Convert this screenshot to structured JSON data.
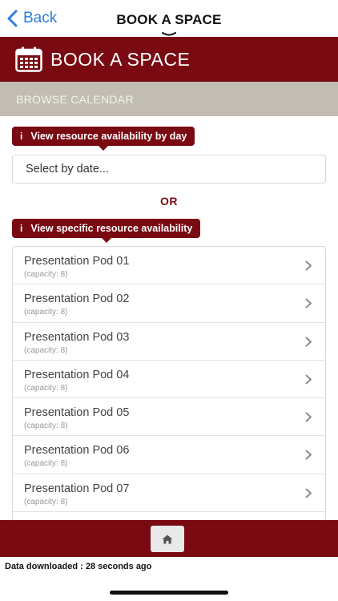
{
  "navbar": {
    "back_label": "Back",
    "title": "BOOK A SPACE"
  },
  "header": {
    "icon": "calendar-icon",
    "title": "BOOK A SPACE"
  },
  "browse": {
    "label": "BROWSE CALENDAR"
  },
  "by_day": {
    "info_glyph": "i",
    "label": "View resource availability by day",
    "date_placeholder": "Select by date..."
  },
  "or_label": "OR",
  "specific": {
    "info_glyph": "i",
    "label": "View specific resource availability"
  },
  "resources": [
    {
      "name": "Presentation Pod 01",
      "capacity": "(capacity: 8)"
    },
    {
      "name": "Presentation Pod 02",
      "capacity": "(capacity: 8)"
    },
    {
      "name": "Presentation Pod 03",
      "capacity": "(capacity: 8)"
    },
    {
      "name": "Presentation Pod 04",
      "capacity": "(capacity: 8)"
    },
    {
      "name": "Presentation Pod 05",
      "capacity": "(capacity: 8)"
    },
    {
      "name": "Presentation Pod 06",
      "capacity": "(capacity: 8)"
    },
    {
      "name": "Presentation Pod 07",
      "capacity": "(capacity: 8)"
    },
    {
      "name": "",
      "capacity": ""
    }
  ],
  "footer": {
    "home_icon": "home-icon"
  },
  "status_text": "Data downloaded : 28 seconds ago",
  "colors": {
    "brand": "#7a0a12",
    "browse_bar": "#c2bdb2",
    "link": "#2a7fe0"
  }
}
